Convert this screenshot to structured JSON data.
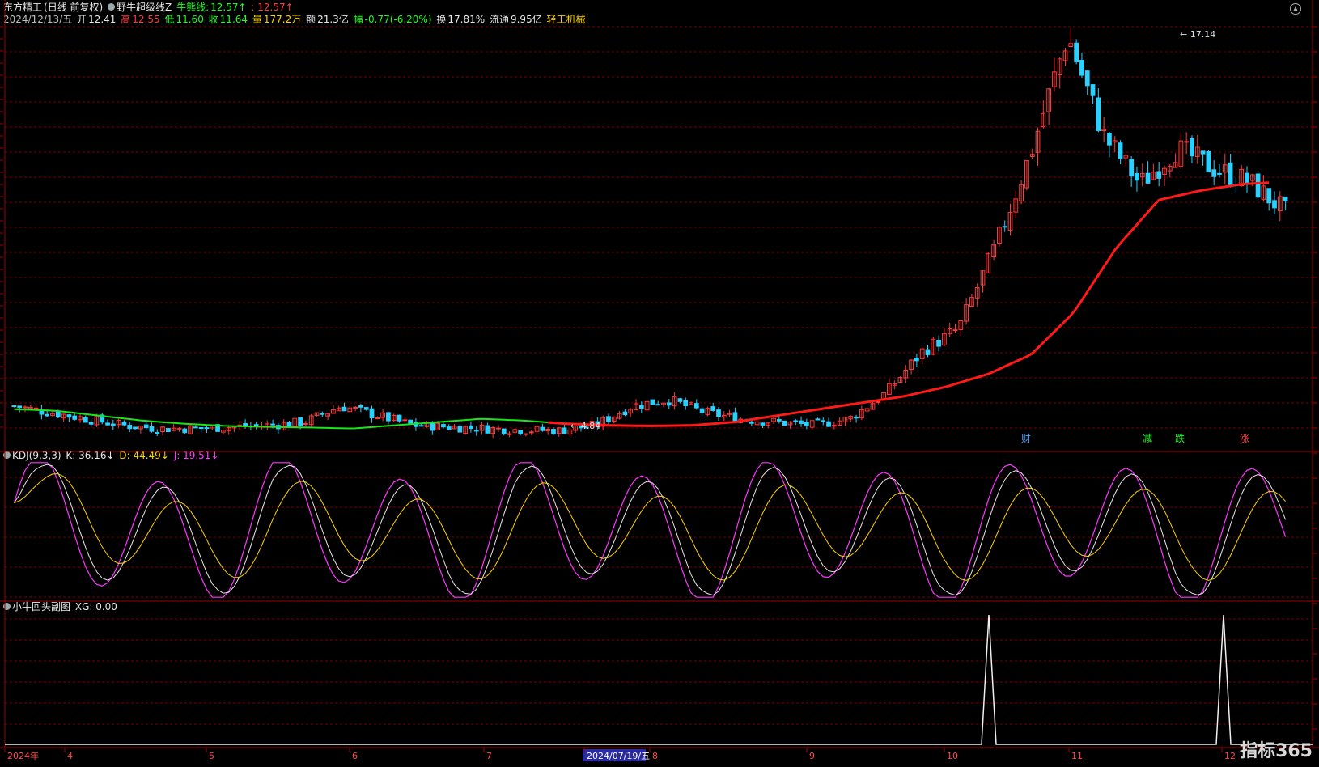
{
  "header": {
    "stock_name": "东方精工",
    "mode": "(日线 前复权)",
    "indicator_name": "野牛超级线Z",
    "bull_label": "牛熊线:",
    "bull_value": "12.57↑",
    "bull_value2": ": 12.57↑",
    "date": "2024/12/13/五",
    "open_label": "开",
    "open": "12.41",
    "high_label": "高",
    "high": "12.55",
    "low_label": "低",
    "low": "11.60",
    "close_label": "收",
    "close": "11.64",
    "vol_label": "量",
    "vol": "177.2万",
    "amount_label": "额",
    "amount": "21.3亿",
    "change_label": "幅",
    "change": "-0.77(-6.20%)",
    "turnover_label": "换",
    "turnover": "17.81%",
    "float_label": "流通",
    "float": "9.95亿",
    "industry": "轻工机械"
  },
  "kdj_header": {
    "name": "KDJ(9,3,3)",
    "k": "K: 36.16↓",
    "d": "D: 44.49↓",
    "j": "J: 19.51↓"
  },
  "sub_header": {
    "name": "小牛回头副图",
    "xg": "XG: 0.00"
  },
  "price_annotations": {
    "max_label": "17.14",
    "min_label": "4.84"
  },
  "event_markers": [
    "财",
    "减",
    "跌",
    "涨"
  ],
  "x_axis": {
    "labels": [
      "2024年",
      "4",
      "5",
      "6",
      "7",
      "2024/07/19/五",
      "8",
      "9",
      "10",
      "11",
      "12"
    ]
  },
  "logo_text": "指标365",
  "colors": {
    "up": "#ff3b3b",
    "down": "#2ad1ff",
    "ma_green": "#19e619",
    "ma_red": "#ff1a1a",
    "k_line": "#e8e8e8",
    "d_line": "#ffd400",
    "j_line": "#ff37ff",
    "grid": "#7a0000",
    "border": "#a00000"
  },
  "chart_data": [
    {
      "type": "candlestick",
      "title": "东方精工 (日线 前复权)",
      "series": [
        {
          "name": "daily_ohlc",
          "values_note": "approximate closes read from chart",
          "values": [
            5.6,
            5.4,
            5.2,
            5.0,
            4.9,
            4.9,
            4.95,
            5.0,
            5.1,
            5.6,
            5.3,
            5.0,
            4.95,
            4.9,
            4.85,
            4.84,
            5.0,
            5.6,
            5.8,
            5.4,
            5.2,
            5.1,
            5.0,
            5.2,
            6.0,
            7.3,
            8.0,
            10.5,
            13.5,
            17.14,
            14.0,
            12.5,
            13.6,
            13.0,
            12.57,
            11.64
          ]
        },
        {
          "name": "牛熊线",
          "values": [
            5.5,
            5.45,
            5.3,
            5.15,
            5.05,
            4.98,
            4.95,
            4.93,
            4.9,
            5.0,
            5.1,
            5.2,
            5.15,
            5.05,
            5.0,
            4.98,
            5.0,
            5.1,
            5.3,
            5.5,
            5.7,
            5.9,
            6.2,
            6.6,
            7.2,
            8.5,
            10.5,
            12.0,
            12.3,
            12.5,
            12.57
          ]
        }
      ],
      "annotations": {
        "max": 17.14,
        "min": 4.84
      }
    },
    {
      "type": "line",
      "title": "KDJ(9,3,3)",
      "series": [
        {
          "name": "K",
          "last": 36.16
        },
        {
          "name": "D",
          "last": 44.49
        },
        {
          "name": "J",
          "last": 19.51
        }
      ]
    },
    {
      "type": "line",
      "title": "小牛回头副图",
      "series": [
        {
          "name": "XG",
          "last": 0.0,
          "spikes_at_month": [
            "10",
            "12"
          ]
        }
      ]
    }
  ]
}
